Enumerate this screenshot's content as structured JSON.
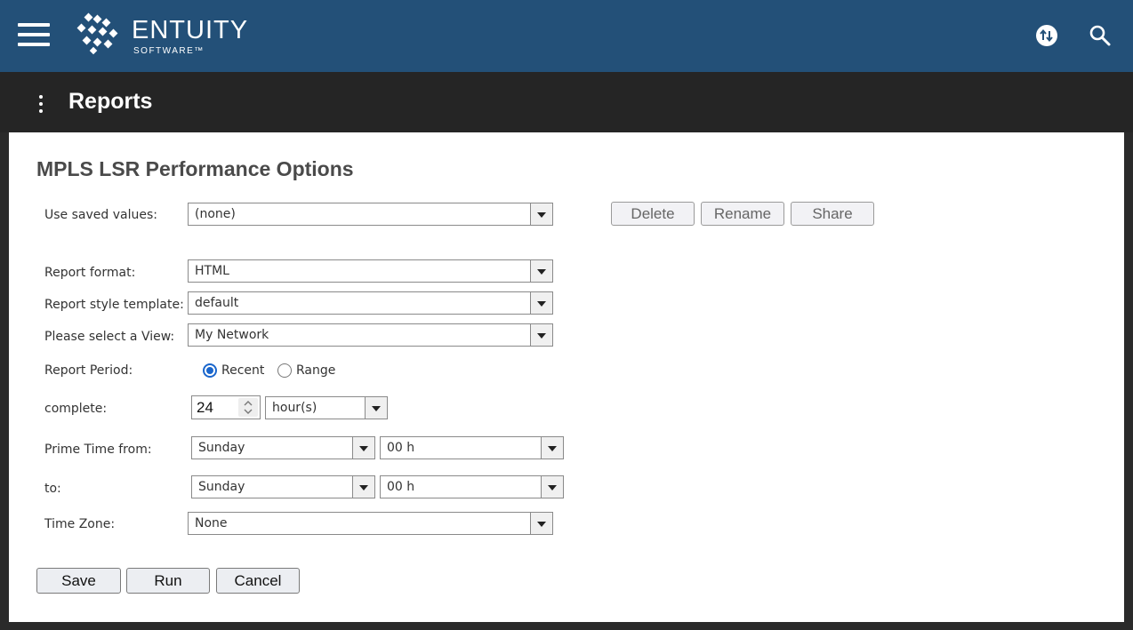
{
  "header": {
    "logo_text": "ENTUITY",
    "logo_sub": "SOFTWARE™",
    "icons": [
      "menu-icon",
      "logo-icon",
      "sync-icon",
      "search-icon"
    ]
  },
  "subheader": {
    "title": "Reports"
  },
  "form": {
    "title": "MPLS LSR Performance Options",
    "saved_values": {
      "label": "Use saved values:",
      "value": "(none)"
    },
    "saved_buttons": {
      "delete": "Delete",
      "rename": "Rename",
      "share": "Share"
    },
    "report_format": {
      "label": "Report format:",
      "value": "HTML"
    },
    "style_template": {
      "label": "Report style template:",
      "value": "default"
    },
    "view": {
      "label": "Please select a View:",
      "value": "My Network"
    },
    "report_period": {
      "label": "Report Period:",
      "recent": "Recent",
      "range": "Range",
      "selected": "recent"
    },
    "complete": {
      "label": "complete:",
      "value": "24",
      "unit": "hour(s)"
    },
    "prime_from": {
      "label": "Prime Time from:",
      "day": "Sunday",
      "hour": "00 h"
    },
    "prime_to": {
      "label": "to:",
      "day": "Sunday",
      "hour": "00 h"
    },
    "time_zone": {
      "label": "Time Zone:",
      "value": "None"
    },
    "actions": {
      "save": "Save",
      "run": "Run",
      "cancel": "Cancel"
    }
  },
  "colors": {
    "topbar": "#235078",
    "subbar": "#252525",
    "radio_accent": "#1a66cc"
  }
}
